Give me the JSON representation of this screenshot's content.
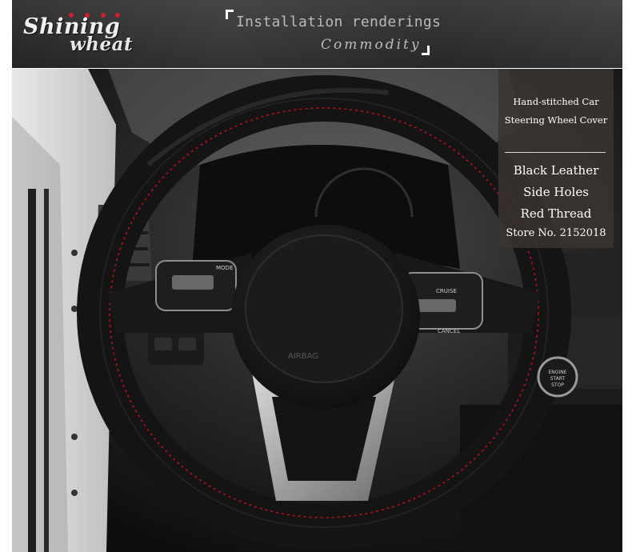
{
  "header": {
    "logo_line1": "Shining",
    "logo_line2": "wheat",
    "title": "Installation renderings",
    "subtitle": "Commodity"
  },
  "info_card": {
    "title_line1": "Hand-stitched Car",
    "title_line2": "Steering Wheel Cover",
    "features": [
      "Black Leather",
      "Side Holes",
      "Red Thread"
    ],
    "store": "Store No. 2152018"
  },
  "photo": {
    "airbag_label": "AIRBAG",
    "mode_label": "MODE",
    "cruise_label": "CRUISE",
    "ok_label": "OK",
    "cancel_label": "CANCEL",
    "engine_label_1": "ENGINE",
    "engine_label_2": "START",
    "engine_label_3": "STOP"
  },
  "colors": {
    "banner": "#333333",
    "leather": "#151515",
    "stitch": "#b5121b",
    "card": "#3a342e"
  }
}
